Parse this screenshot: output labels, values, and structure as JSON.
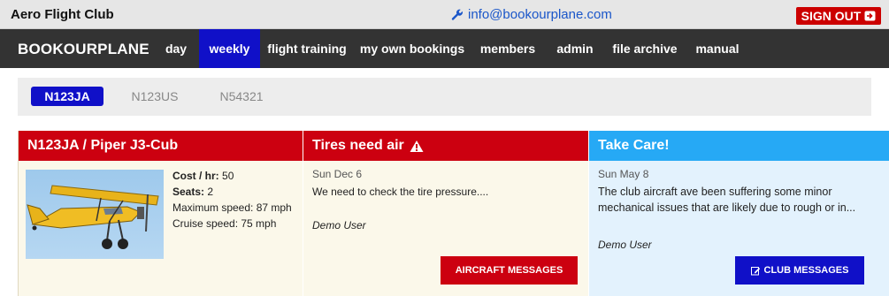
{
  "header": {
    "club_name": "Aero Flight Club",
    "email": "info@bookourplane.com",
    "sign_out": "SIGN OUT"
  },
  "nav": {
    "brand": "BOOKOURPLANE",
    "items": [
      {
        "label": "day",
        "active": false
      },
      {
        "label": "weekly",
        "active": true
      },
      {
        "label": "flight training",
        "active": false
      },
      {
        "label": "my own bookings",
        "active": false
      },
      {
        "label": "members",
        "active": false
      },
      {
        "label": "admin",
        "active": false
      },
      {
        "label": "file archive",
        "active": false
      },
      {
        "label": "manual",
        "active": false
      }
    ]
  },
  "aircraft_tabs": [
    {
      "label": "N123JA",
      "active": true
    },
    {
      "label": "N123US",
      "active": false
    },
    {
      "label": "N54321",
      "active": false
    }
  ],
  "aircraft_panel": {
    "title": "N123JA / Piper J3-Cub",
    "cost_label": "Cost / hr:",
    "cost_value": "50",
    "seats_label": "Seats:",
    "seats_value": "2",
    "max_speed": "Maximum speed: 87 mph",
    "cruise_speed": "Cruise speed: 75 mph"
  },
  "aircraft_message": {
    "title": "Tires need air",
    "date": "Sun Dec 6",
    "text": "We need to check the tire pressure....",
    "user": "Demo User",
    "button": "AIRCRAFT MESSAGES",
    "icon": "warning-icon"
  },
  "club_message": {
    "title": "Take Care!",
    "date": "Sun May 8",
    "text_line1": "The club aircraft ave been suffering some minor",
    "text_line2": "mechanical issues that are likely due to rough or in...",
    "user": "Demo User",
    "button": "CLUB MESSAGES",
    "icon": "edit-icon"
  },
  "colors": {
    "brand_blue": "#1010c8",
    "alert_red": "#cc0010",
    "info_blue": "#26a9f5",
    "navbar": "#333333"
  }
}
